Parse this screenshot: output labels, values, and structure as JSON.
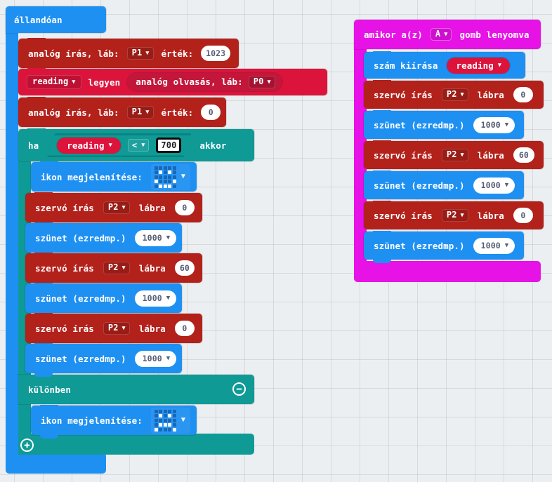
{
  "canvas": {
    "background_color": "#eceff1",
    "grid": "dot-plus-grid"
  },
  "palette": {
    "loops_blue": "#1e90f2",
    "pins_dark_red": "#b3211b",
    "variables_crimson": "#dc143c",
    "logic_teal": "#0f9a96",
    "input_magenta": "#e612e6",
    "field_white": "#ffffff"
  },
  "scripts": {
    "forever_stack": {
      "hat_label": "állandóan",
      "blocks": {
        "analog_write_high": {
          "label_pin": "analóg írás, láb:",
          "pin_value": "P1",
          "label_value": "érték:",
          "value": "1023"
        },
        "set_variable": {
          "variable": "reading",
          "label_set": "legyen",
          "analog_read_label": "analóg olvasás, láb:",
          "analog_read_pin": "P0"
        },
        "analog_write_low": {
          "label_pin": "analóg írás, láb:",
          "pin_value": "P1",
          "label_value": "érték:",
          "value": "0"
        },
        "if_block": {
          "label_if": "ha",
          "condition_variable": "reading",
          "operator": "<",
          "compare_value": "700",
          "compare_value_selected": true,
          "label_then": "akkor",
          "label_else": "különben",
          "collapse_icon": "minus-circle-icon",
          "expand_icon": "plus-circle-icon"
        },
        "show_icon_then": {
          "label": "ikon megjelenítése:",
          "icon_name": "happy-face-icon",
          "matrix": [
            [
              0,
              0,
              0,
              0,
              0
            ],
            [
              0,
              1,
              0,
              1,
              0
            ],
            [
              0,
              0,
              0,
              0,
              0
            ],
            [
              1,
              0,
              0,
              0,
              1
            ],
            [
              0,
              1,
              1,
              1,
              0
            ]
          ]
        },
        "show_icon_else": {
          "label": "ikon megjelenítése:",
          "icon_name": "sad-face-icon",
          "matrix": [
            [
              0,
              0,
              0,
              0,
              0
            ],
            [
              0,
              1,
              0,
              1,
              0
            ],
            [
              0,
              0,
              0,
              0,
              0
            ],
            [
              0,
              1,
              1,
              1,
              0
            ],
            [
              1,
              0,
              0,
              0,
              1
            ]
          ]
        },
        "servo_sequence": [
          {
            "type": "servo",
            "label_write": "szervó írás",
            "pin": "P2",
            "label_to": "lábra",
            "angle": "0"
          },
          {
            "type": "pause",
            "label": "szünet (ezredmp.)",
            "duration": "1000"
          },
          {
            "type": "servo",
            "label_write": "szervó írás",
            "pin": "P2",
            "label_to": "lábra",
            "angle": "60"
          },
          {
            "type": "pause",
            "label": "szünet (ezredmp.)",
            "duration": "1000"
          },
          {
            "type": "servo",
            "label_write": "szervó írás",
            "pin": "P2",
            "label_to": "lábra",
            "angle": "0"
          },
          {
            "type": "pause",
            "label": "szünet (ezredmp.)",
            "duration": "1000"
          }
        ]
      }
    },
    "on_button_stack": {
      "hat_label_prefix": "amikor a(z)",
      "hat_button": "A",
      "hat_label_suffix": "gomb lenyomva",
      "show_number": {
        "label": "szám kiírása",
        "variable": "reading"
      },
      "servo_sequence": [
        {
          "type": "servo",
          "label_write": "szervó írás",
          "pin": "P2",
          "label_to": "lábra",
          "angle": "0"
        },
        {
          "type": "pause",
          "label": "szünet (ezredmp.)",
          "duration": "1000"
        },
        {
          "type": "servo",
          "label_write": "szervó írás",
          "pin": "P2",
          "label_to": "lábra",
          "angle": "60"
        },
        {
          "type": "pause",
          "label": "szünet (ezredmp.)",
          "duration": "1000"
        },
        {
          "type": "servo",
          "label_write": "szervó írás",
          "pin": "P2",
          "label_to": "lábra",
          "angle": "0"
        },
        {
          "type": "pause",
          "label": "szünet (ezredmp.)",
          "duration": "1000"
        }
      ]
    }
  }
}
